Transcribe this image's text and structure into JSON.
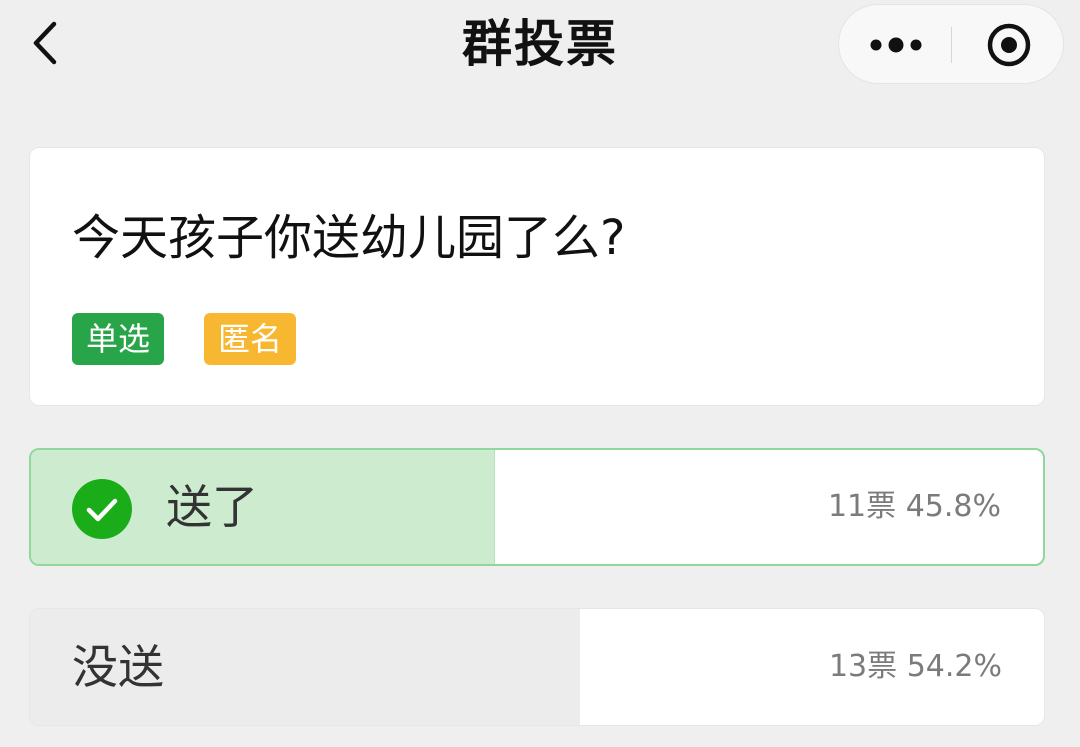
{
  "nav": {
    "title": "群投票",
    "back_icon": "chevron-left-icon",
    "more_icon": "more-dots-icon",
    "close_icon": "target-close-icon"
  },
  "poll": {
    "question": "今天孩子你送幼儿园了么?",
    "tags": [
      {
        "label": "单选",
        "color": "#27a548"
      },
      {
        "label": "匿名",
        "color": "#f7b731"
      }
    ]
  },
  "options": [
    {
      "label": "送了",
      "votes_text": "11票",
      "percent_text": "45.8%",
      "percent": 45.8,
      "selected": true
    },
    {
      "label": "没送",
      "votes_text": "13票",
      "percent_text": "54.2%",
      "percent": 54.2,
      "selected": false
    }
  ],
  "colors": {
    "accent": "#27a548",
    "selected_fill": "#cdeccf",
    "unselected_fill": "#ececec",
    "check": "#1aad19"
  }
}
